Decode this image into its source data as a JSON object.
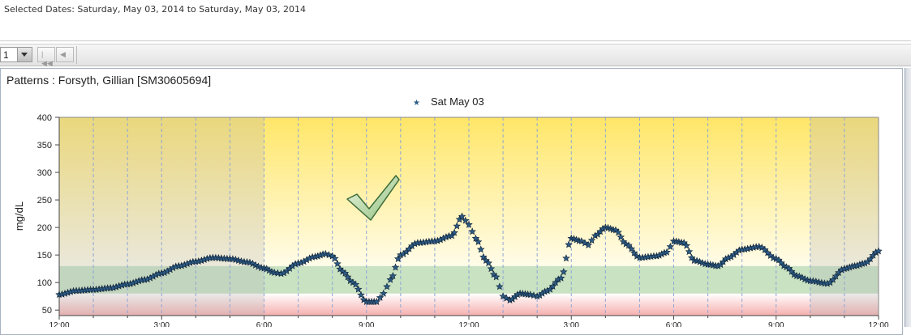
{
  "header": {
    "selected_dates": "Selected Dates: Saturday, May 03, 2014 to Saturday, May 03, 2014"
  },
  "toolbar": {
    "page_value": "1",
    "first_glyph": "|◀◀",
    "prev_glyph": "◀"
  },
  "panel": {
    "title": "Patterns : Forsyth, Gillian [SM30605694]"
  },
  "annotation": {
    "icon": "checkmark-icon"
  },
  "chart_data": {
    "type": "scatter",
    "ylabel": "mg/dL",
    "ylim": [
      40,
      400
    ],
    "yticks": [
      50,
      100,
      150,
      200,
      250,
      300,
      350,
      400
    ],
    "xlim": [
      0,
      24
    ],
    "xticks": [
      0,
      3,
      6,
      9,
      12,
      15,
      18,
      21,
      24
    ],
    "xtick_labels": [
      "12:00",
      "3:00",
      "6:00",
      "9:00",
      "12:00",
      "3:00",
      "6:00",
      "9:00",
      "12:00"
    ],
    "bands": [
      {
        "from": 40,
        "to": 80,
        "color": "#f6c9c9"
      },
      {
        "from": 80,
        "to": 130,
        "color": "#c3dfbe"
      },
      {
        "from": 130,
        "to": 400,
        "color": "#fff2a6"
      }
    ],
    "shaded_periods": [
      {
        "from": 0,
        "to": 6
      },
      {
        "from": 22,
        "to": 24
      }
    ],
    "marker_color": "#2d5c86",
    "series": [
      {
        "name": "Sat May 03",
        "points": [
          [
            0.0,
            78
          ],
          [
            0.5,
            85
          ],
          [
            1.0,
            87
          ],
          [
            1.5,
            90
          ],
          [
            2.0,
            97
          ],
          [
            2.5,
            105
          ],
          [
            3.0,
            117
          ],
          [
            3.5,
            130
          ],
          [
            4.0,
            138
          ],
          [
            4.5,
            145
          ],
          [
            5.0,
            143
          ],
          [
            5.5,
            137
          ],
          [
            6.0,
            126
          ],
          [
            6.3,
            118
          ],
          [
            6.5,
            116
          ],
          [
            7.0,
            135
          ],
          [
            7.5,
            147
          ],
          [
            7.8,
            152
          ],
          [
            8.0,
            148
          ],
          [
            8.3,
            120
          ],
          [
            8.6,
            100
          ],
          [
            9.0,
            65
          ],
          [
            9.3,
            65
          ],
          [
            9.5,
            80
          ],
          [
            9.7,
            105
          ],
          [
            10.0,
            150
          ],
          [
            10.5,
            172
          ],
          [
            11.0,
            175
          ],
          [
            11.5,
            185
          ],
          [
            11.8,
            220
          ],
          [
            12.0,
            205
          ],
          [
            12.2,
            180
          ],
          [
            12.5,
            140
          ],
          [
            12.8,
            110
          ],
          [
            13.0,
            75
          ],
          [
            13.2,
            68
          ],
          [
            13.5,
            80
          ],
          [
            13.8,
            78
          ],
          [
            14.0,
            75
          ],
          [
            14.3,
            85
          ],
          [
            14.7,
            108
          ],
          [
            15.0,
            180
          ],
          [
            15.3,
            175
          ],
          [
            15.5,
            168
          ],
          [
            15.7,
            185
          ],
          [
            16.0,
            200
          ],
          [
            16.3,
            195
          ],
          [
            16.6,
            170
          ],
          [
            17.0,
            145
          ],
          [
            17.5,
            148
          ],
          [
            17.8,
            155
          ],
          [
            18.0,
            175
          ],
          [
            18.3,
            172
          ],
          [
            18.6,
            140
          ],
          [
            19.0,
            133
          ],
          [
            19.3,
            130
          ],
          [
            19.6,
            145
          ],
          [
            20.0,
            160
          ],
          [
            20.5,
            165
          ],
          [
            21.0,
            143
          ],
          [
            21.3,
            128
          ],
          [
            21.6,
            112
          ],
          [
            22.0,
            103
          ],
          [
            22.5,
            98
          ],
          [
            23.0,
            125
          ],
          [
            23.3,
            130
          ],
          [
            23.6,
            135
          ],
          [
            24.0,
            157
          ]
        ]
      }
    ]
  }
}
